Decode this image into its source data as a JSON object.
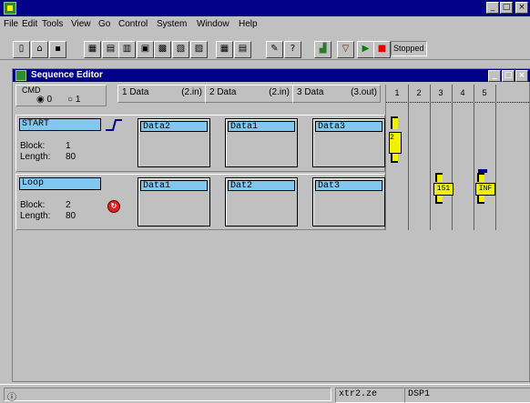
{
  "menu": [
    "File",
    "Edit",
    "Tools",
    "View",
    "Go",
    "Control",
    "System",
    "Window",
    "Help"
  ],
  "window_controls": [
    "_",
    "□",
    "×"
  ],
  "toolbar": {
    "status_field": "Stopped"
  },
  "editor": {
    "title": "Sequence Editor",
    "cmd_label": "CMD",
    "radio_0": "0",
    "radio_1": "1",
    "tabs": [
      {
        "label": "1 Data",
        "suffix": "(2.in)"
      },
      {
        "label": "2 Data",
        "suffix": "(2.in)"
      },
      {
        "label": "3 Data",
        "suffix": "(3.out)"
      }
    ],
    "channels": [
      "1",
      "2",
      "3",
      "4",
      "5"
    ],
    "blocks": [
      {
        "name": "START",
        "block_label": "Block:",
        "block_value": "1",
        "length_label": "Length:",
        "length_value": "80",
        "cells": [
          "Data2",
          "Data1",
          "Data3"
        ]
      },
      {
        "name": "Loop",
        "block_label": "Block:",
        "block_value": "2",
        "length_label": "Length:",
        "length_value": "80",
        "cells": [
          "Data1",
          "Dat2",
          "Dat3"
        ]
      }
    ],
    "markers": [
      {
        "channel": "1",
        "label": "2"
      },
      {
        "channel": "3",
        "label": "151"
      },
      {
        "channel": "5",
        "label": "INF"
      }
    ]
  },
  "status": {
    "field1": "xtr2.ze",
    "field2": "DSP1"
  },
  "colors": {
    "title_blue": "#000088",
    "cell_blue": "#80c8f0",
    "marker_yellow": "#f0f000",
    "face": "#c0c0c0"
  }
}
